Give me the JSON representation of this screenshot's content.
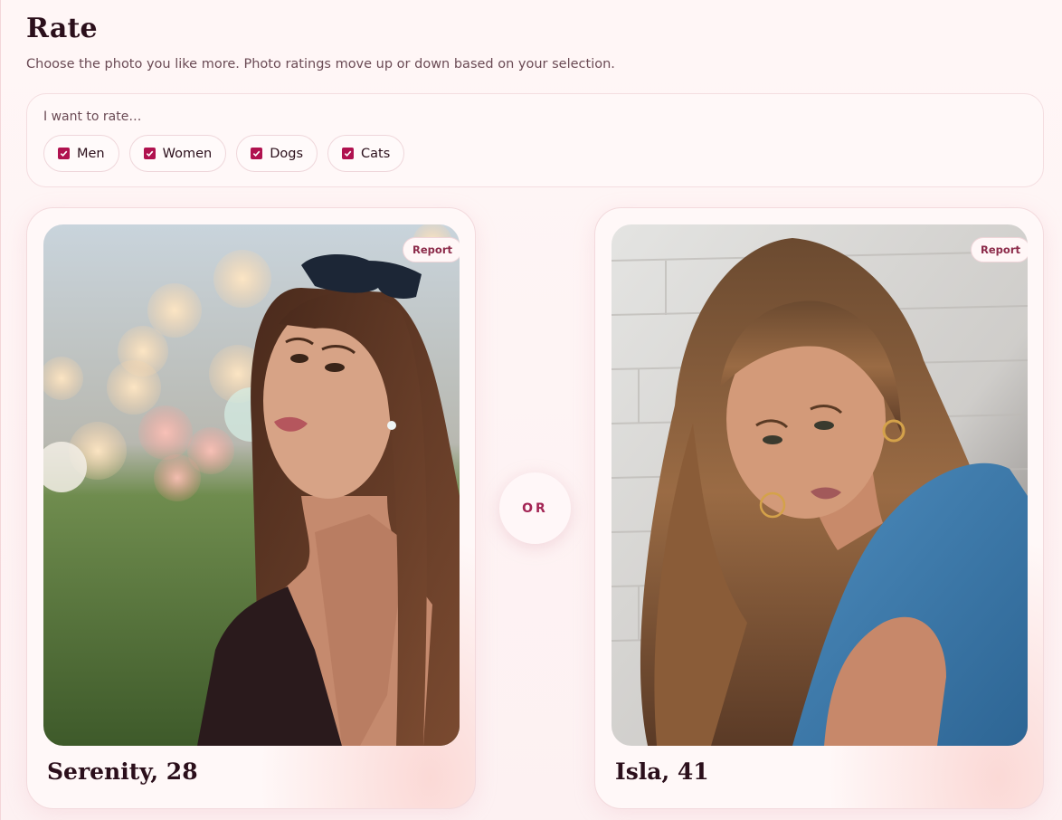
{
  "page": {
    "title": "Rate",
    "subtitle": "Choose the photo you like more. Photo ratings move up or down based on your selection."
  },
  "filter": {
    "label": "I want to rate…",
    "options": [
      {
        "label": "Men",
        "checked": true
      },
      {
        "label": "Women",
        "checked": true
      },
      {
        "label": "Dogs",
        "checked": true
      },
      {
        "label": "Cats",
        "checked": true
      }
    ]
  },
  "candidates": [
    {
      "name_age": "Serenity, 28",
      "report_label": "Report",
      "photo": "woman-portrait-bokeh-background"
    },
    {
      "name_age": "Isla, 41",
      "report_label": "Report",
      "photo": "woman-portrait-brick-wall"
    }
  ],
  "divider": {
    "label": "OR"
  },
  "colors": {
    "accent": "#b0124f",
    "background": "#fdf3f3",
    "text": "#2b0f1b"
  }
}
